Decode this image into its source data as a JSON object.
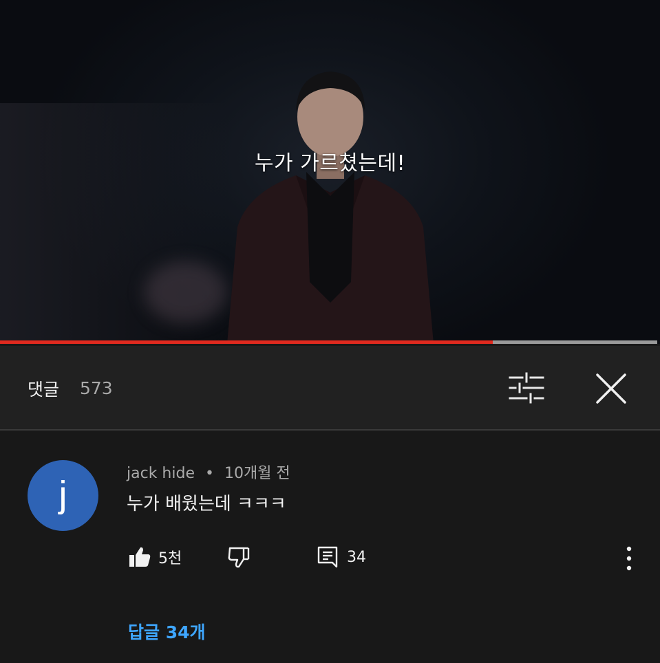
{
  "video": {
    "subtitle": "누가 가르쳤는데!",
    "progress_fraction": 0.75,
    "progress_color": "#e02a1f"
  },
  "comments_header": {
    "title": "댓글",
    "count": "573",
    "sort_icon": "sort-filter-icon",
    "close_icon": "close-icon"
  },
  "comment": {
    "avatar_letter": "j",
    "avatar_color": "#2e63b5",
    "author": "jack hide",
    "separator": "•",
    "time": "10개월 전",
    "text": "누가 배웠는데 ㅋㅋㅋ",
    "likes": "5천",
    "replies_count": "34",
    "replies_link": "답글 34개",
    "link_color": "#3ea6ff"
  }
}
